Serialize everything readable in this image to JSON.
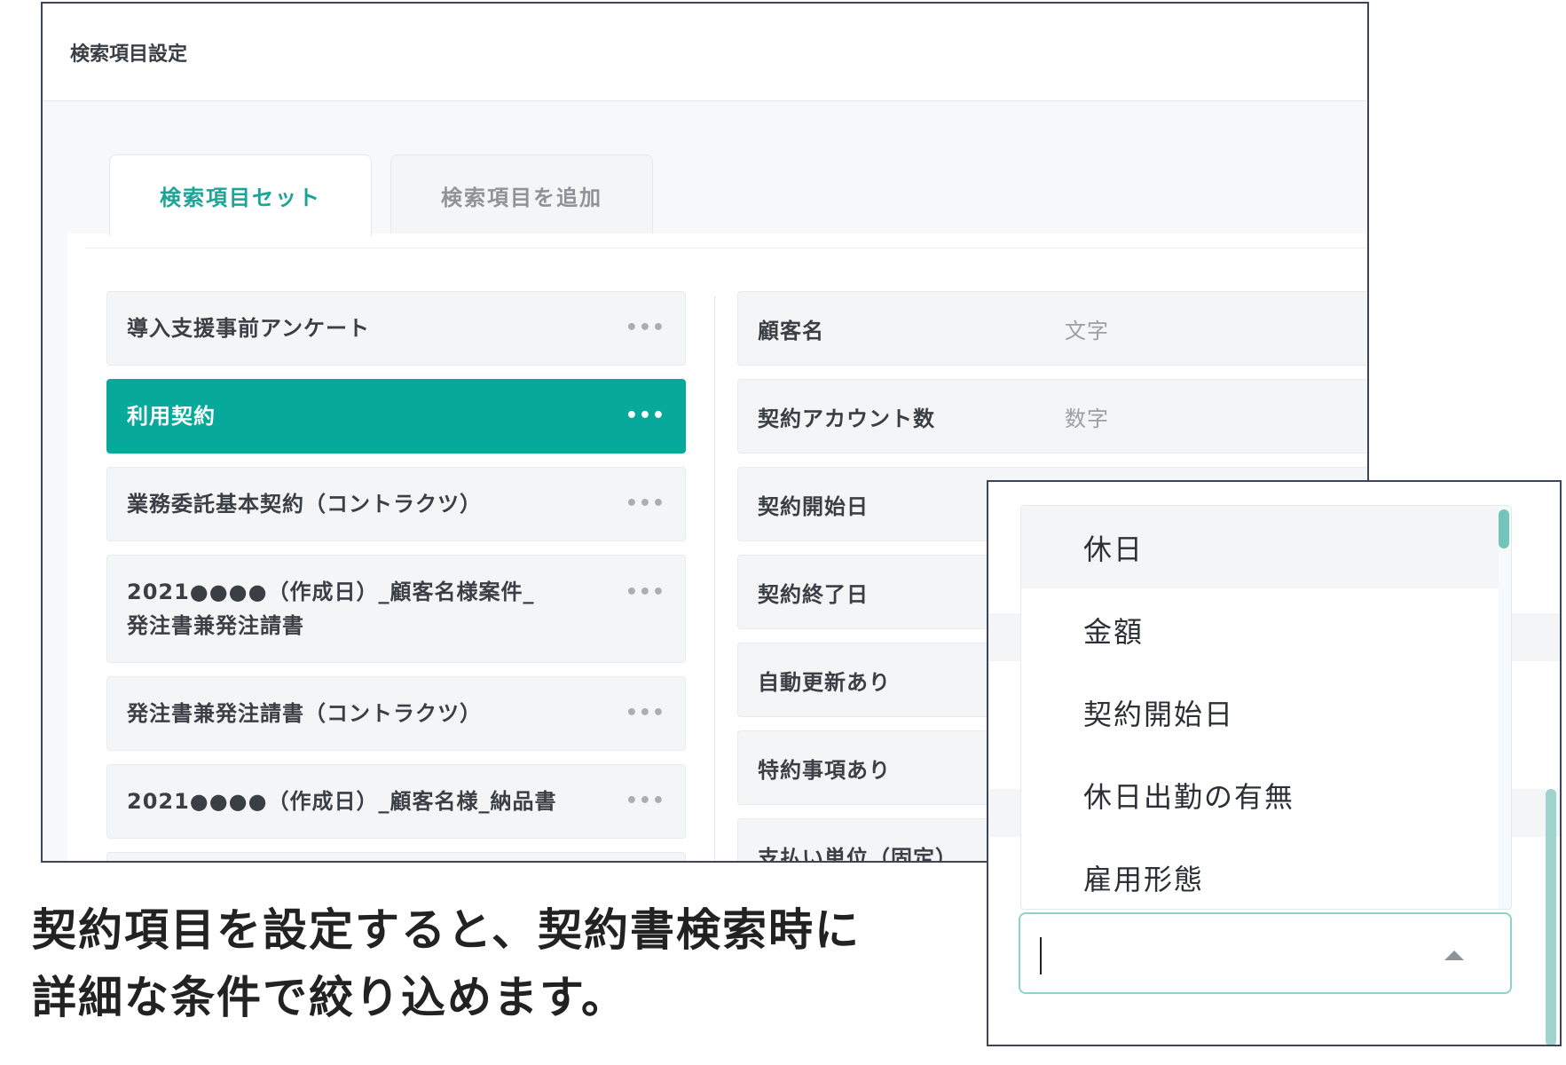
{
  "header": {
    "title": "検索項目設定"
  },
  "tabs": [
    {
      "label": "検索項目セット",
      "active": true
    },
    {
      "label": "検索項目を追加",
      "active": false
    }
  ],
  "sets": [
    {
      "label": "導入支援事前アンケート",
      "active": false
    },
    {
      "label": "利用契約",
      "active": true
    },
    {
      "label": "業務委託基本契約（コントラクツ）",
      "active": false
    },
    {
      "label": "2021●●●●（作成日）_顧客名様案件_発注書兼発注請書",
      "active": false
    },
    {
      "label": "発注書兼発注請書（コントラクツ）",
      "active": false
    },
    {
      "label": "2021●●●●（作成日）_顧客名様_納品書",
      "active": false
    }
  ],
  "more_icon": "•••",
  "fields": [
    {
      "name": "顧客名",
      "type": "文字"
    },
    {
      "name": "契約アカウント数",
      "type": "数字"
    },
    {
      "name": "契約開始日",
      "type": ""
    },
    {
      "name": "契約終了日",
      "type": ""
    },
    {
      "name": "自動更新あり",
      "type": ""
    },
    {
      "name": "特約事項あり",
      "type": ""
    },
    {
      "name": "支払い単位（固定）",
      "type": ""
    }
  ],
  "caption": {
    "line1": "契約項目を設定すると、契約書検索時に",
    "line2": "詳細な条件で絞り込めます。"
  },
  "dropdown": {
    "options": [
      "休日",
      "金額",
      "契約開始日",
      "休日出勤の有無",
      "雇用形態"
    ],
    "hovered_index": 0,
    "input_value": "",
    "accent_color": "#07a99a"
  },
  "icons": {
    "more": "more-dots-icon",
    "dropdown_toggle": "chevron-up-icon"
  }
}
